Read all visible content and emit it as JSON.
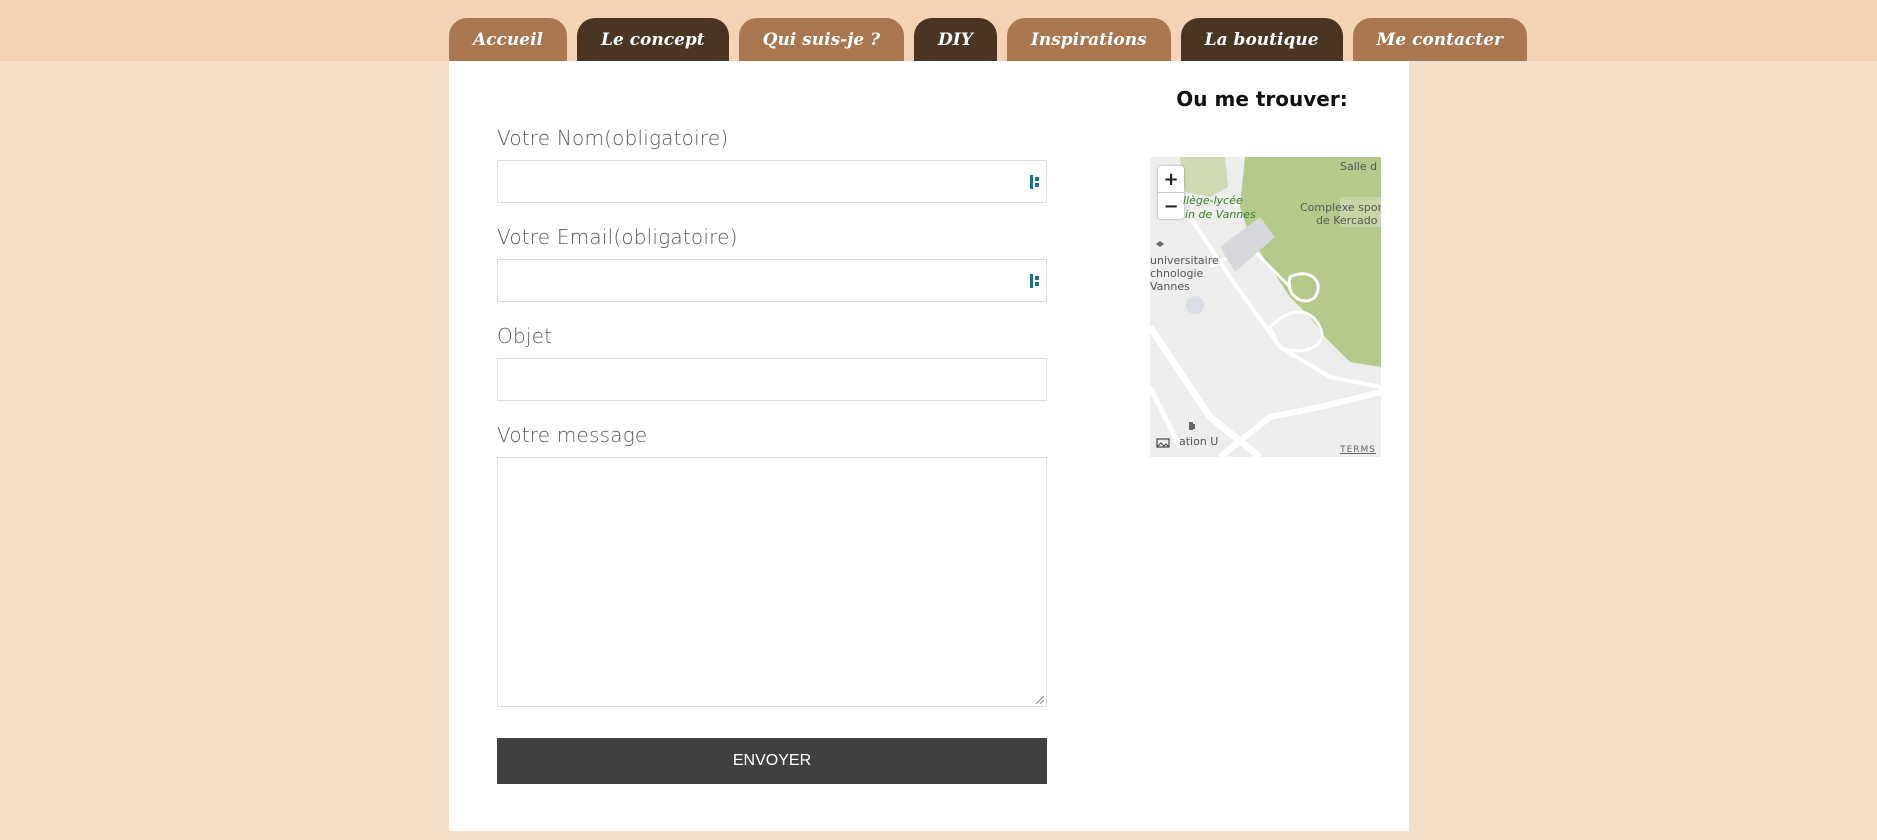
{
  "nav": {
    "tabs": [
      {
        "label": "Accueil"
      },
      {
        "label": "Le concept"
      },
      {
        "label": "Qui suis-je ?"
      },
      {
        "label": "DIY"
      },
      {
        "label": "Inspirations"
      },
      {
        "label": "La boutique"
      },
      {
        "label": "Me contacter"
      }
    ]
  },
  "form": {
    "name_label": "Votre Nom(obligatoire)",
    "name_value": "",
    "email_label": "Votre Email(obligatoire)",
    "email_value": "",
    "subject_label": "Objet",
    "subject_value": "",
    "message_label": "Votre message",
    "message_value": "",
    "submit_label": "ENVOYER"
  },
  "sidebar": {
    "title": "Ou me trouver:",
    "map": {
      "zoom_in": "+",
      "zoom_out": "−",
      "labels": {
        "salle": "Salle d",
        "college_1": "llège-lycée",
        "college_2": "in de Vannes",
        "complexe_1": "Complexe spor",
        "complexe_2": "de Kercado",
        "iut_1": "universitaire",
        "iut_2": "chnologie",
        "iut_3": "Vannes",
        "station": "ation U"
      },
      "terms": "TERMS"
    }
  },
  "colors": {
    "tab_light": "#a9774f",
    "tab_dark": "#4a3422",
    "page_background": "#f3dfca",
    "header_band": "#f3d3b4",
    "button": "#404040"
  }
}
